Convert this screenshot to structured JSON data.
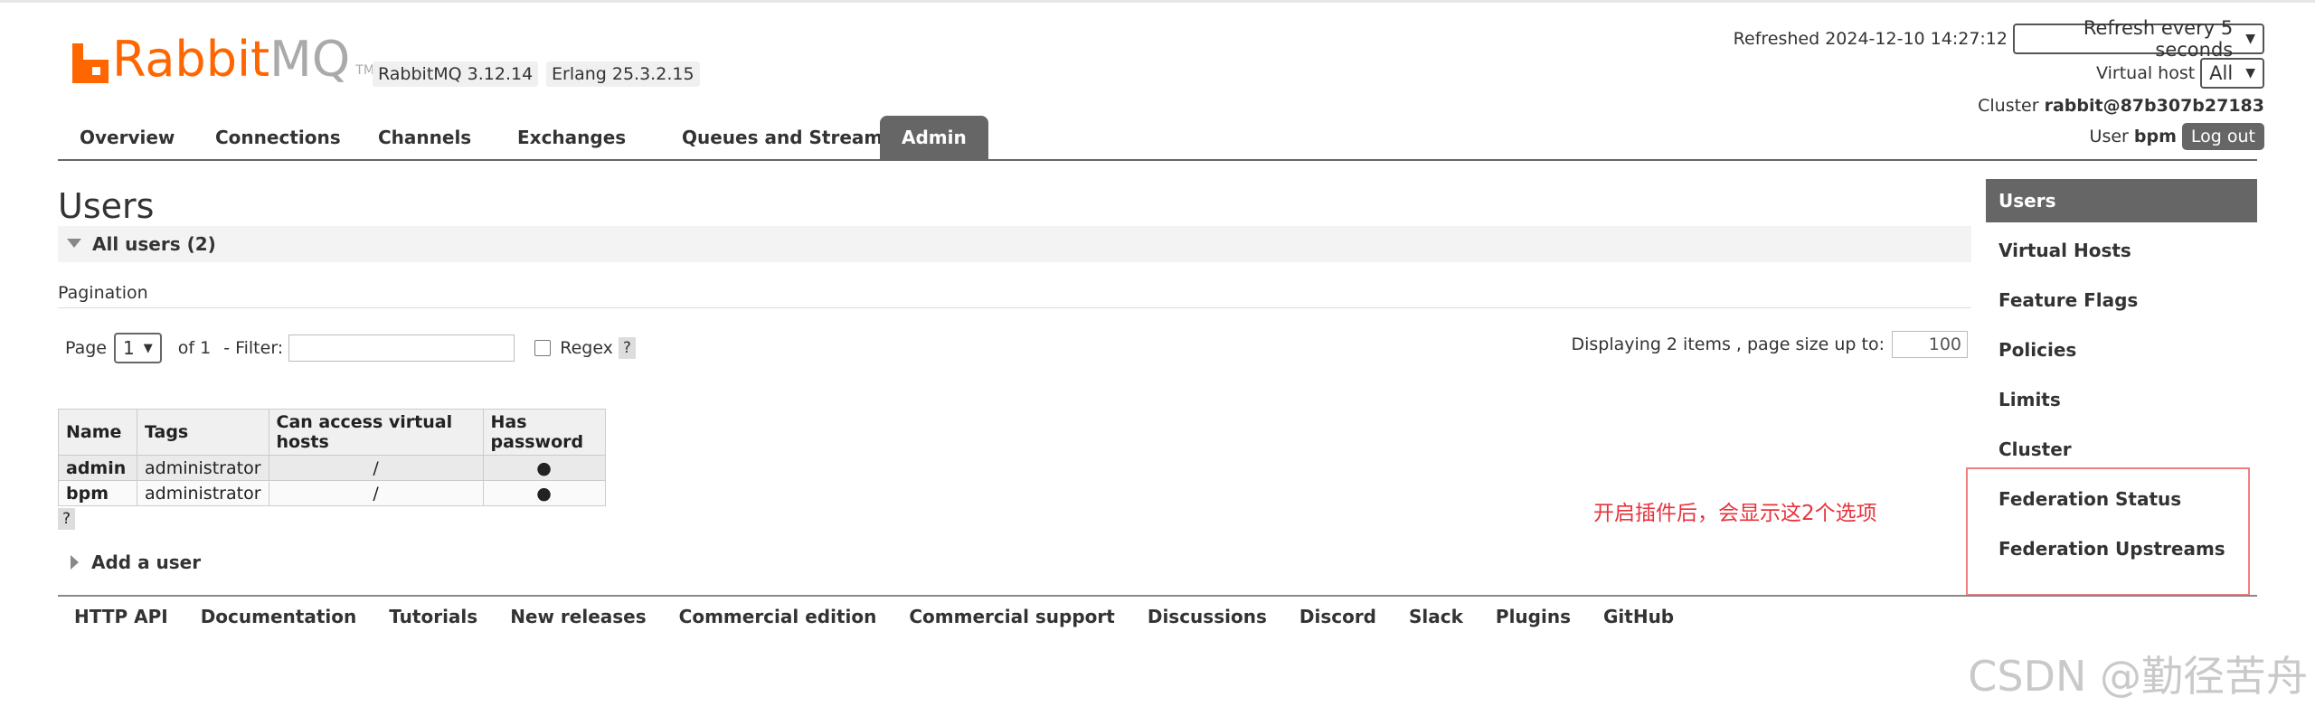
{
  "header": {
    "logo_rabbit": "Rabbit",
    "logo_mq": "MQ",
    "logo_tm": "TM",
    "rabbitmq_version": "RabbitMQ 3.12.14",
    "erlang_version": "Erlang 25.3.2.15",
    "refreshed_label": "Refreshed 2024-12-10 14:27:12",
    "refresh_select": "Refresh every 5 seconds",
    "vhost_label": "Virtual host",
    "vhost_select": "All",
    "cluster_label": "Cluster",
    "cluster_name": "rabbit@87b307b27183",
    "user_label": "User",
    "user_name": "bpm",
    "logout_label": "Log out"
  },
  "tabs": [
    {
      "label": "Overview"
    },
    {
      "label": "Connections"
    },
    {
      "label": "Channels"
    },
    {
      "label": "Exchanges"
    },
    {
      "label": "Queues and Streams"
    },
    {
      "label": "Admin"
    }
  ],
  "page": {
    "title": "Users",
    "section_label": "All users (2)",
    "pagination_title": "Pagination",
    "page_label": "Page",
    "page_select": "1",
    "of_label": "of 1",
    "filter_label": "- Filter:",
    "regex_label": "Regex",
    "help": "?",
    "display_label": "Displaying 2 items , page size up to:",
    "page_size": "100",
    "add_user": "Add a user"
  },
  "table": {
    "headers": [
      "Name",
      "Tags",
      "Can access virtual hosts",
      "Has password"
    ],
    "rows": [
      [
        "admin",
        "administrator",
        "/",
        "●"
      ],
      [
        "bpm",
        "administrator",
        "/",
        "●"
      ]
    ]
  },
  "sidebar": {
    "items": [
      {
        "label": "Users"
      },
      {
        "label": "Virtual Hosts"
      },
      {
        "label": "Feature Flags"
      },
      {
        "label": "Policies"
      },
      {
        "label": "Limits"
      },
      {
        "label": "Cluster"
      },
      {
        "label": "Federation Status"
      },
      {
        "label": "Federation Upstreams"
      }
    ]
  },
  "annotation": "开启插件后，会显示这2个选项",
  "footer": {
    "links": [
      "HTTP API",
      "Documentation",
      "Tutorials",
      "New releases",
      "Commercial edition",
      "Commercial support",
      "Discussions",
      "Discord",
      "Slack",
      "Plugins",
      "GitHub"
    ]
  },
  "watermark": "CSDN @勤径苦舟",
  "colors": {
    "brand": "#ff6600",
    "tab_active": "#666666",
    "annotation": "#e8323c"
  }
}
